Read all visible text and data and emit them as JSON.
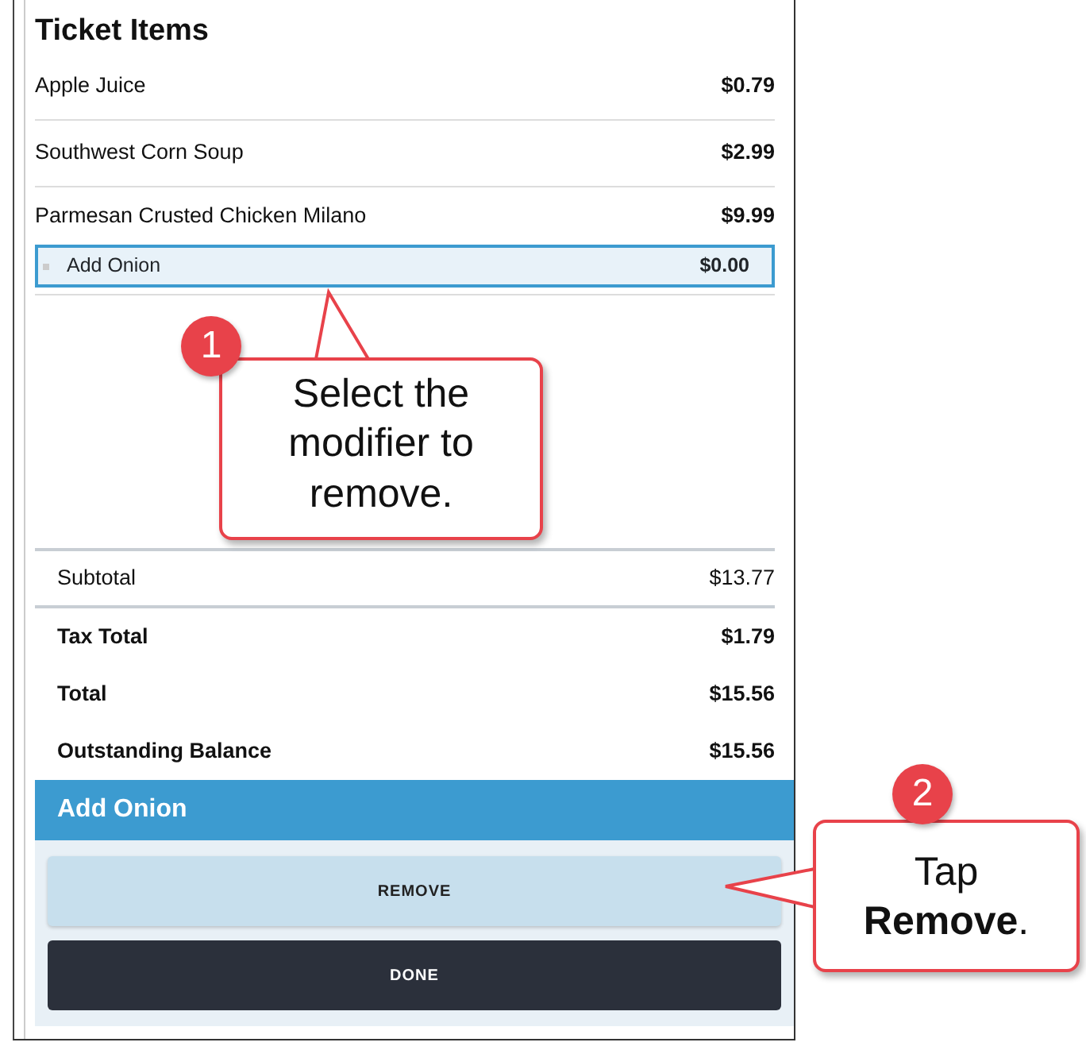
{
  "ticket": {
    "title": "Ticket Items",
    "items": [
      {
        "name": "Apple Juice",
        "price": "$0.79",
        "kind": "item",
        "selected": false
      },
      {
        "name": "Southwest Corn Soup",
        "price": "$2.99",
        "kind": "item",
        "selected": false
      },
      {
        "name": "Parmesan Crusted Chicken Milano",
        "price": "$9.99",
        "kind": "item",
        "selected": false
      },
      {
        "name": "Add Onion",
        "price": "$0.00",
        "kind": "modifier",
        "selected": true
      }
    ]
  },
  "totals": [
    {
      "label": "Subtotal",
      "amount": "$13.77",
      "bold": false
    },
    {
      "label": "Tax Total",
      "amount": "$1.79",
      "bold": true
    },
    {
      "label": "Total",
      "amount": "$15.56",
      "bold": true
    },
    {
      "label": "Outstanding Balance",
      "amount": "$15.56",
      "bold": true
    }
  ],
  "modifier_panel": {
    "title": "Add Onion",
    "buttons": [
      {
        "label": "REMOVE",
        "kind": "secondary"
      },
      {
        "label": "DONE",
        "kind": "primary"
      }
    ]
  },
  "callouts": [
    {
      "number": "1",
      "text": "Select the modifier to remove."
    },
    {
      "number": "2",
      "text": "Tap **Remove**."
    }
  ]
}
